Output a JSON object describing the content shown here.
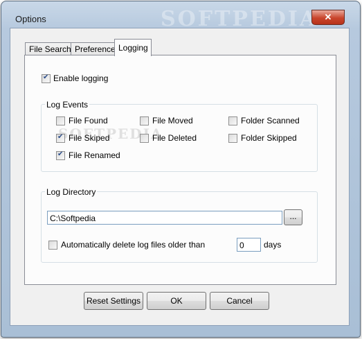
{
  "window": {
    "title": "Options",
    "watermark": "SOFTPEDIA",
    "close_glyph": "✕"
  },
  "tabs": [
    {
      "label": "File Search",
      "active": false
    },
    {
      "label": "Preference",
      "active": false
    },
    {
      "label": "Logging",
      "active": true
    }
  ],
  "logging": {
    "enable_label": "Enable logging",
    "enable_checked": true,
    "events_group_title": "Log Events",
    "events": [
      {
        "label": "File Found",
        "checked": false
      },
      {
        "label": "File Moved",
        "checked": false
      },
      {
        "label": "Folder Scanned",
        "checked": false
      },
      {
        "label": "File Skiped",
        "checked": true
      },
      {
        "label": "File Deleted",
        "checked": false
      },
      {
        "label": "Folder Skipped",
        "checked": false
      },
      {
        "label": "File Renamed",
        "checked": true
      }
    ],
    "directory_group_title": "Log Directory",
    "directory_value": "C:\\Softpedia",
    "browse_label": "...",
    "auto_delete_label": "Automatically delete log files older than",
    "auto_delete_checked": false,
    "days_value": "0",
    "days_label": "days"
  },
  "buttons": {
    "reset": "Reset Settings",
    "ok": "OK",
    "cancel": "Cancel"
  }
}
